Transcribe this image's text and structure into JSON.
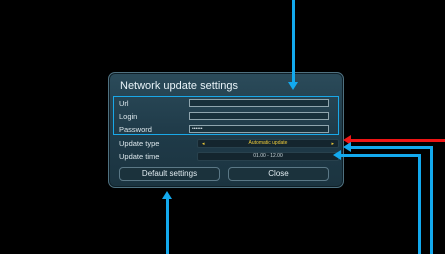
{
  "dialog": {
    "title": "Network update settings"
  },
  "fields": {
    "url_label": "Url",
    "url_value": "",
    "login_label": "Login",
    "login_value": "",
    "password_label": "Password",
    "password_value": "••••••"
  },
  "settings": {
    "update_type_label": "Update type",
    "update_type_value": "Automatic update",
    "update_time_label": "Update time",
    "update_time_value": "01.00 - 12.00"
  },
  "buttons": {
    "default_settings": "Default settings",
    "close": "Close"
  },
  "glyphs": {
    "left": "◂",
    "right": "▸"
  },
  "colors": {
    "annotation_blue": "#13a9ee",
    "annotation_red": "#ef1515",
    "select_text": "#eecb39"
  }
}
